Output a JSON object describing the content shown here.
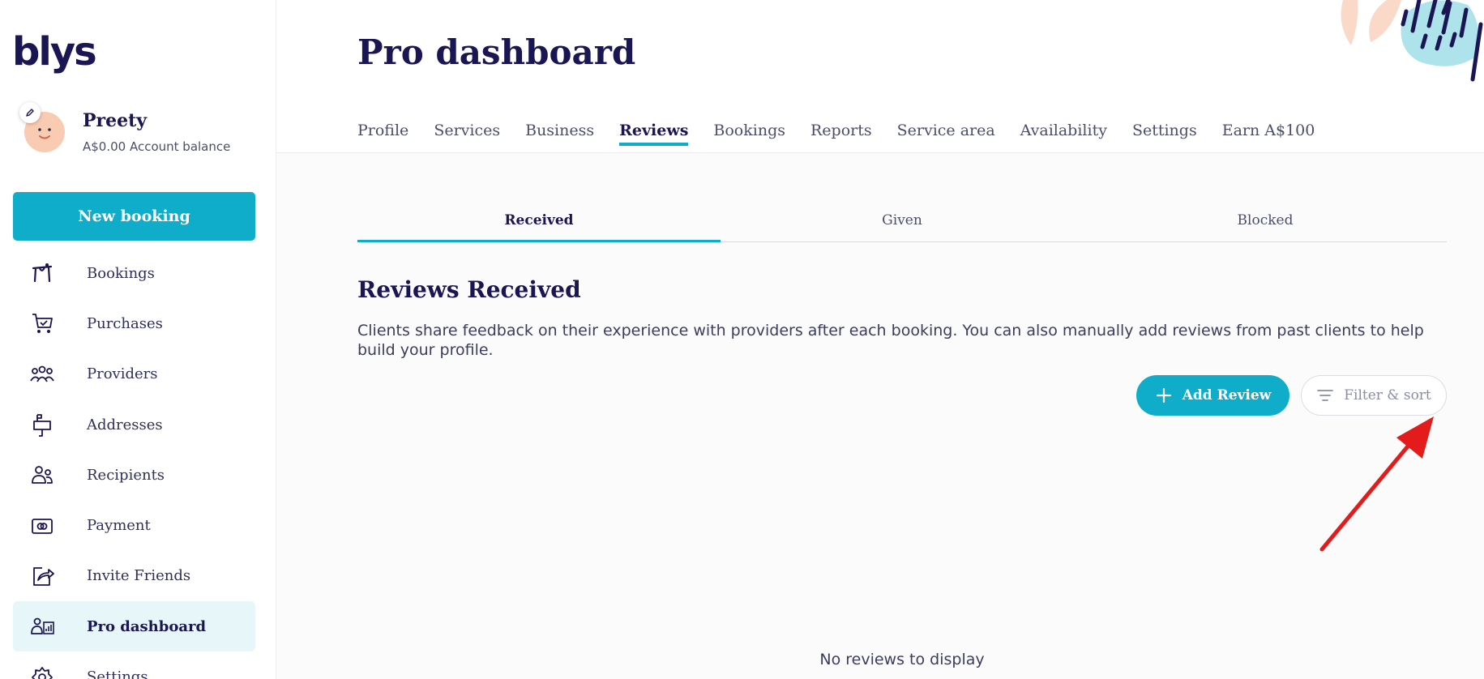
{
  "brand": {
    "logo_text": "blys",
    "accent_color": "#10adcb",
    "text_color": "#1a1553"
  },
  "user": {
    "name": "Preety",
    "balance": "A$0.00 Account balance"
  },
  "sidebar": {
    "new_booking_label": "New booking",
    "items": [
      {
        "label": "Bookings",
        "icon": "booking-table-icon"
      },
      {
        "label": "Purchases",
        "icon": "cart-icon"
      },
      {
        "label": "Providers",
        "icon": "group-icon"
      },
      {
        "label": "Addresses",
        "icon": "mailbox-icon"
      },
      {
        "label": "Recipients",
        "icon": "people-icon"
      },
      {
        "label": "Payment",
        "icon": "card-icon"
      },
      {
        "label": "Invite Friends",
        "icon": "share-icon"
      },
      {
        "label": "Pro dashboard",
        "icon": "pro-dashboard-icon",
        "active": true
      },
      {
        "label": "Settings",
        "icon": "gear-icon"
      }
    ]
  },
  "header": {
    "title": "Pro dashboard",
    "tabs": [
      {
        "label": "Profile"
      },
      {
        "label": "Services"
      },
      {
        "label": "Business"
      },
      {
        "label": "Reviews",
        "active": true
      },
      {
        "label": "Bookings"
      },
      {
        "label": "Reports"
      },
      {
        "label": "Service area"
      },
      {
        "label": "Availability"
      },
      {
        "label": "Settings"
      },
      {
        "label": "Earn A$100"
      }
    ]
  },
  "reviews": {
    "subtabs": [
      {
        "label": "Received",
        "active": true
      },
      {
        "label": "Given"
      },
      {
        "label": "Blocked"
      }
    ],
    "section_title": "Reviews Received",
    "description": "Clients share feedback on their experience with providers after each booking. You can also manually add reviews from past clients to help build your profile.",
    "add_review_label": "Add Review",
    "filter_sort_label": "Filter & sort",
    "empty_text": "No reviews to display"
  }
}
